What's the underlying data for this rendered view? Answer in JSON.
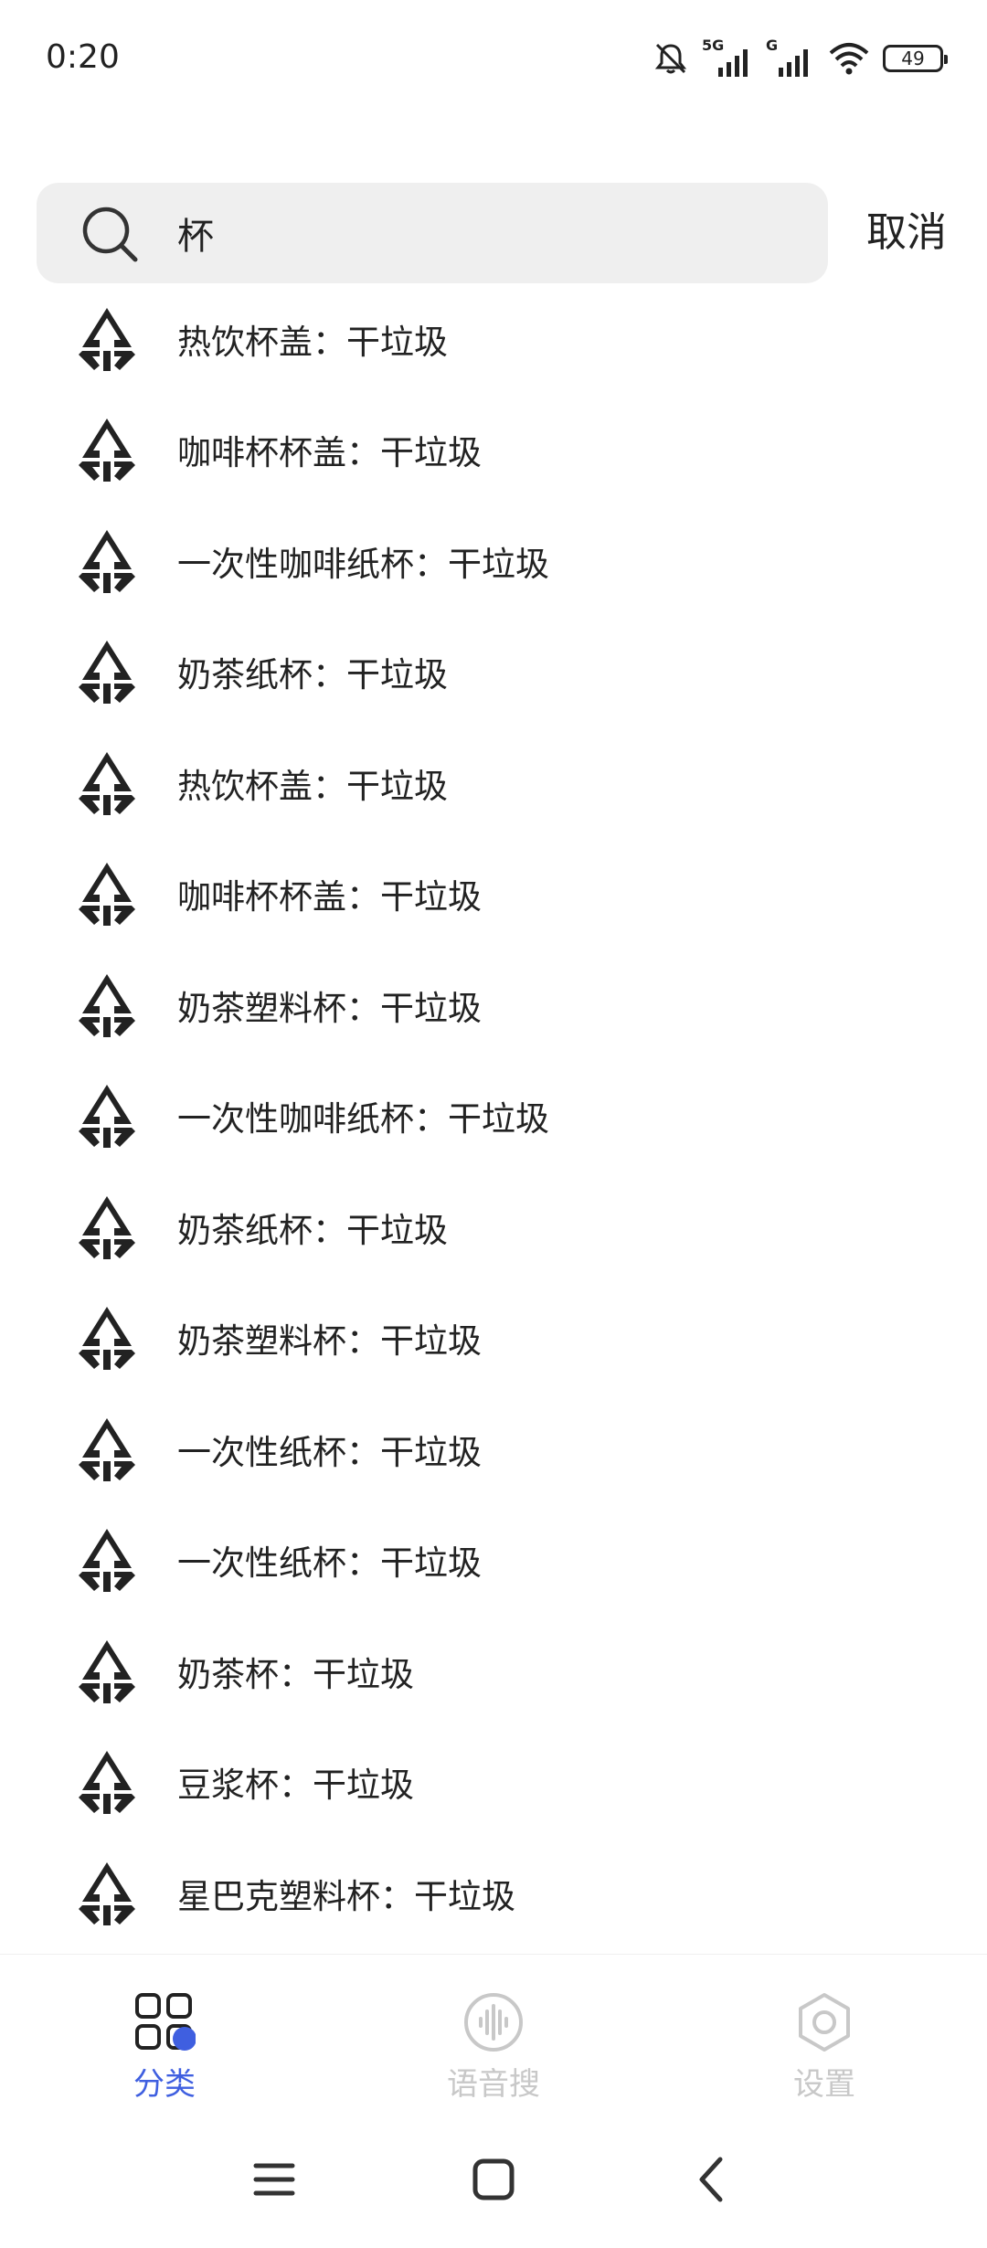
{
  "status_bar": {
    "time": "0:20",
    "battery": "49",
    "network_labels": [
      "5G",
      "G"
    ]
  },
  "search": {
    "query": "杯",
    "cancel_label": "取消"
  },
  "results": [
    "热饮杯盖：干垃圾",
    "咖啡杯杯盖：干垃圾",
    "一次性咖啡纸杯：干垃圾",
    "奶茶纸杯：干垃圾",
    "热饮杯盖：干垃圾",
    "咖啡杯杯盖：干垃圾",
    "奶茶塑料杯：干垃圾",
    "一次性咖啡纸杯：干垃圾",
    "奶茶纸杯：干垃圾",
    "奶茶塑料杯：干垃圾",
    "一次性纸杯：干垃圾",
    "一次性纸杯：干垃圾",
    "奶茶杯：干垃圾",
    "豆浆杯：干垃圾",
    "星巴克塑料杯：干垃圾"
  ],
  "result_icon": "dry-waste-icon",
  "bottom_nav": {
    "items": [
      {
        "label": "分类",
        "icon": "category-icon",
        "active": true
      },
      {
        "label": "语音搜",
        "icon": "voice-search-icon",
        "active": false
      },
      {
        "label": "设置",
        "icon": "settings-icon",
        "active": false
      }
    ],
    "active_color": "#3f5fe0",
    "inactive_color": "#c8c8c8"
  },
  "system_nav": {
    "items": [
      "menu-icon",
      "home-icon",
      "back-icon"
    ]
  }
}
